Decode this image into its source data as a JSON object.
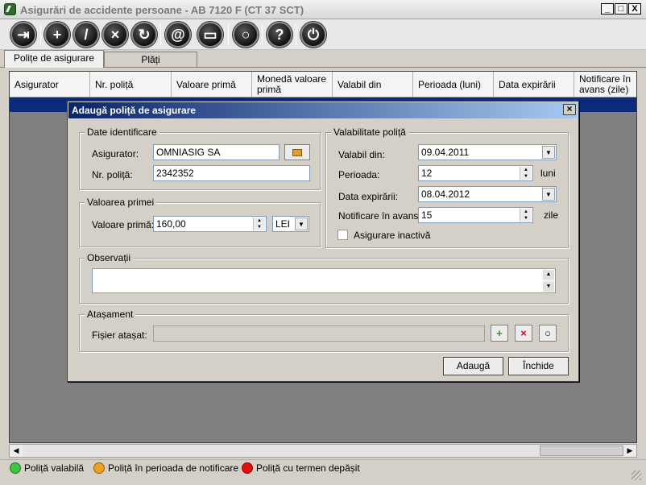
{
  "window": {
    "title": "Asigurări de accidente persoane - AB 7120 F (CT 37 SCT)",
    "controls": [
      "_",
      "□",
      "X"
    ]
  },
  "toolbar": {
    "buttons": [
      {
        "icon": "exit-icon",
        "glyph": "⇥"
      },
      {
        "icon": "add-icon",
        "glyph": "+"
      },
      {
        "icon": "edit-icon",
        "glyph": "/"
      },
      {
        "icon": "delete-icon",
        "glyph": "×"
      },
      {
        "icon": "refresh-icon",
        "glyph": "↻"
      },
      {
        "icon": "email-icon",
        "glyph": "@"
      },
      {
        "icon": "print-icon",
        "glyph": "▭"
      },
      {
        "icon": "search-icon",
        "glyph": "○"
      },
      {
        "icon": "help-icon",
        "glyph": "?"
      },
      {
        "icon": "power-icon",
        "glyph": "⏻"
      }
    ]
  },
  "tabs": [
    "Polițe de asigurare",
    "Plăți"
  ],
  "grid": {
    "columns": [
      "Asigurator",
      "Nr. poliță",
      "Valoare primă",
      "Monedă valoare primă",
      "Valabil din",
      "Perioada (luni)",
      "Data expirării",
      "Notificare în avans (zile)"
    ]
  },
  "legend": [
    {
      "label": "Poliță valabilă",
      "color": "#3ec43e"
    },
    {
      "label": "Poliță în perioada de notificare",
      "color": "#f0a020"
    },
    {
      "label": "Poliță cu termen depășit",
      "color": "#e01010"
    }
  ],
  "dialog": {
    "title": "Adaugă poliță de asigurare",
    "close": "×",
    "identification": {
      "legend": "Date identificare",
      "insurer_label": "Asigurator:",
      "insurer_value": "OMNIASIG SA",
      "policy_label": "Nr. poliță:",
      "policy_value": "2342352"
    },
    "premium": {
      "legend": "Valoarea primei",
      "label": "Valoare primă:",
      "value": "160,00",
      "currency": "LEI"
    },
    "validity": {
      "legend": "Valabilitate poliță",
      "from_label": "Valabil din:",
      "from_value": "09.04.2011",
      "period_label": "Perioada:",
      "period_value": "12",
      "period_unit": "luni",
      "expiry_label": "Data expirării:",
      "expiry_value": "08.04.2012",
      "notify_label": "Notificare în avans:",
      "notify_value": "15",
      "notify_unit": "zile",
      "inactive_label": "Asigurare inactivă"
    },
    "notes": {
      "legend": "Observații",
      "value": ""
    },
    "attachment": {
      "legend": "Atașament",
      "file_label": "Fișier atașat:",
      "file_value": ""
    },
    "buttons": {
      "add": "Adaugă",
      "close": "Închide"
    }
  }
}
